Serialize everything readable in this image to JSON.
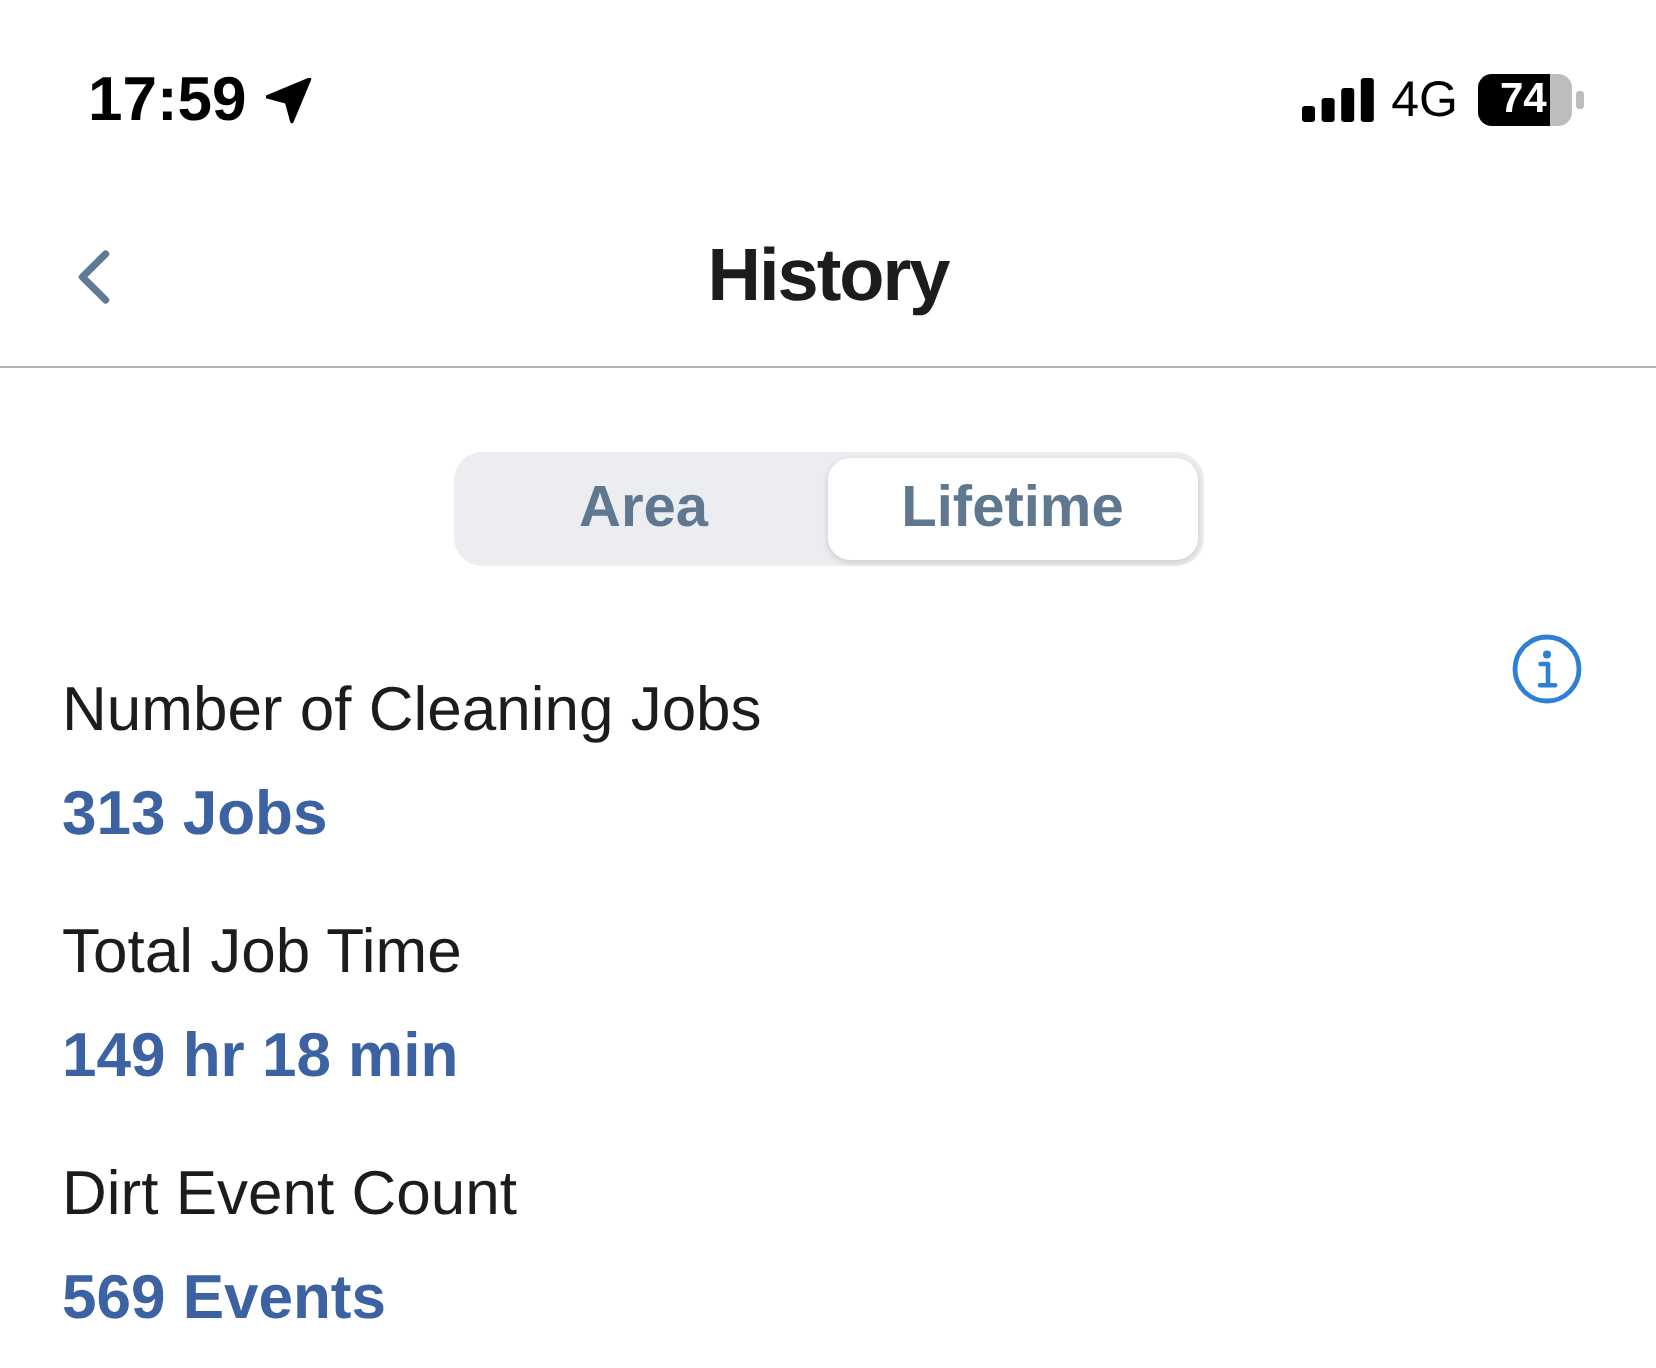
{
  "status_bar": {
    "time": "17:59",
    "network": "4G",
    "battery": "74"
  },
  "nav": {
    "title": "History"
  },
  "segments": [
    {
      "label": "Area",
      "selected": false
    },
    {
      "label": "Lifetime",
      "selected": true
    }
  ],
  "stats": [
    {
      "label": "Number of Cleaning Jobs",
      "value": "313 Jobs"
    },
    {
      "label": "Total Job Time",
      "value": "149 hr 18 min"
    },
    {
      "label": "Dirt Event Count",
      "value": "569 Events"
    }
  ]
}
